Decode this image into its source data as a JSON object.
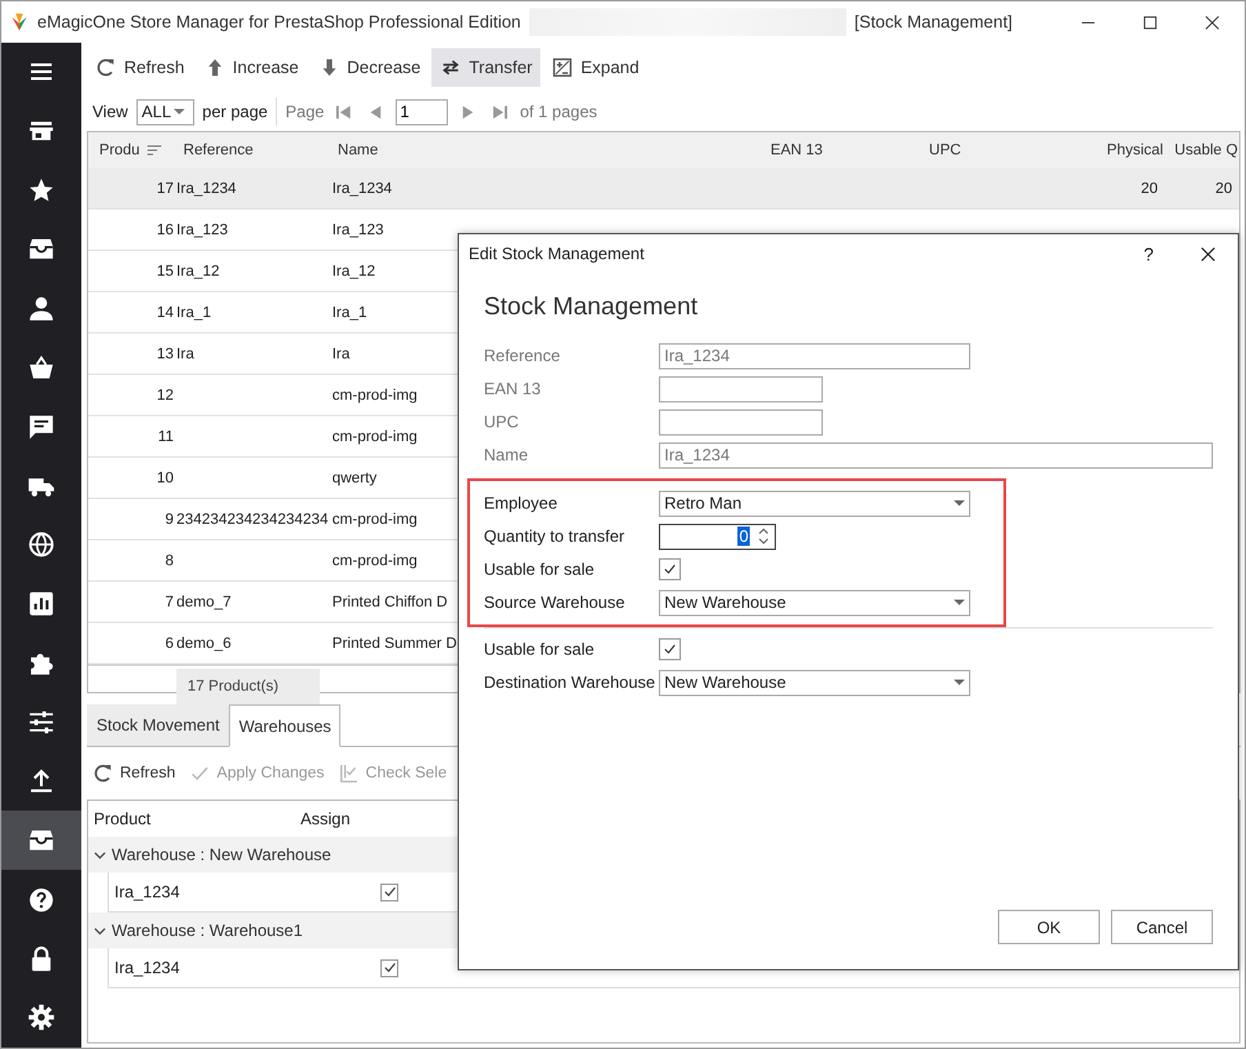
{
  "window": {
    "title": "eMagicOne Store Manager for PrestaShop Professional Edition",
    "subtitle": "[Stock Management]"
  },
  "sidebar": {
    "items": [
      {
        "kind": "menu",
        "selected": false
      },
      {
        "kind": "store",
        "selected": false
      },
      {
        "kind": "star",
        "selected": false
      },
      {
        "kind": "archive",
        "selected": false
      },
      {
        "kind": "person",
        "selected": false
      },
      {
        "kind": "basket",
        "selected": false
      },
      {
        "kind": "chat",
        "selected": false
      },
      {
        "kind": "truck",
        "selected": false
      },
      {
        "kind": "globe",
        "selected": false
      },
      {
        "kind": "chart",
        "selected": false
      },
      {
        "kind": "puzzle",
        "selected": false
      },
      {
        "kind": "sliders",
        "selected": false
      },
      {
        "kind": "upload",
        "selected": false
      },
      {
        "kind": "archive",
        "selected": true
      },
      {
        "kind": "help",
        "selected": false
      },
      {
        "kind": "lock",
        "selected": false
      },
      {
        "kind": "settings",
        "selected": false
      }
    ]
  },
  "toolbar": [
    {
      "kind": "refresh",
      "label": "Refresh",
      "selected": false
    },
    {
      "kind": "up",
      "label": "Increase",
      "selected": false
    },
    {
      "kind": "down",
      "label": "Decrease",
      "selected": false
    },
    {
      "kind": "transfer",
      "label": "Transfer",
      "selected": true
    },
    {
      "kind": "expand",
      "label": "Expand",
      "selected": false
    }
  ],
  "pager": {
    "view_label": "View",
    "view_value": "ALL",
    "per_page": "per page",
    "page_label": "Page",
    "page_value": "1",
    "of_pages": "of 1 pages"
  },
  "grid": {
    "columns": [
      "Produ",
      "Reference",
      "Name",
      "EAN 13",
      "UPC",
      "Physical",
      "Usable Q"
    ],
    "rows": [
      {
        "id": "17",
        "reference": "Ira_1234",
        "name": "Ira_1234",
        "physical": "20",
        "usable": "20",
        "selected": true
      },
      {
        "id": "16",
        "reference": "Ira_123",
        "name": "Ira_123",
        "selected": false
      },
      {
        "id": "15",
        "reference": "Ira_12",
        "name": "Ira_12",
        "selected": false
      },
      {
        "id": "14",
        "reference": "Ira_1",
        "name": "Ira_1",
        "selected": false
      },
      {
        "id": "13",
        "reference": "Ira",
        "name": "Ira",
        "selected": false
      },
      {
        "id": "12",
        "name": "cm-prod-img",
        "selected": false
      },
      {
        "id": "11",
        "name": "cm-prod-img",
        "selected": false
      },
      {
        "id": "10",
        "name": "qwerty",
        "selected": false
      },
      {
        "id": "9",
        "reference": "234234234234234234",
        "name": "cm-prod-img",
        "selected": false
      },
      {
        "id": "8",
        "name": "cm-prod-img",
        "selected": false
      },
      {
        "id": "7",
        "reference": "demo_7",
        "name": "Printed Chiffon D",
        "selected": false
      },
      {
        "id": "6",
        "reference": "demo_6",
        "name": "Printed Summer D",
        "selected": false
      }
    ],
    "footer": "17 Product(s)"
  },
  "bottom": {
    "tabs": [
      {
        "label": "Stock Movement",
        "selected": false
      },
      {
        "label": "Warehouses",
        "selected": true
      }
    ],
    "toolbar": [
      {
        "kind": "refresh",
        "label": "Refresh",
        "disabled": false
      },
      {
        "kind": "check",
        "label": "Apply Changes",
        "disabled": true
      },
      {
        "kind": "check-select",
        "label": "Check Sele",
        "disabled": true
      }
    ],
    "columns": [
      "Product",
      "Assign"
    ],
    "groups": [
      {
        "title": "Warehouse : New Warehouse",
        "expanded": true,
        "rows": [
          {
            "product": "Ira_1234",
            "assigned": true
          }
        ]
      },
      {
        "title": "Warehouse : Warehouse1",
        "expanded": true,
        "rows": [
          {
            "product": "Ira_1234",
            "assigned": true
          }
        ]
      }
    ]
  },
  "dialog": {
    "title": "Edit Stock Management",
    "help": "?",
    "heading": "Stock Management",
    "sections": [
      {
        "highlighted": false,
        "fields": [
          {
            "kind": "text",
            "label": "Reference",
            "value": "Ira_1234",
            "disabled": true
          },
          {
            "kind": "text",
            "label": "EAN 13",
            "disabled": true
          },
          {
            "kind": "text",
            "label": "UPC",
            "disabled": true
          },
          {
            "kind": "text",
            "label": "Name",
            "value": "Ira_1234",
            "disabled": true
          }
        ]
      },
      {
        "highlighted": true,
        "fields": [
          {
            "kind": "combo",
            "label": "Employee",
            "value": "Retro Man",
            "disabled": false
          },
          {
            "kind": "spin",
            "label": "Quantity to transfer",
            "value": "0",
            "disabled": false
          },
          {
            "kind": "checkbox",
            "label": "Usable for sale",
            "checked": true,
            "disabled": false
          },
          {
            "kind": "combo",
            "label": "Source Warehouse",
            "value": "New Warehouse",
            "disabled": false
          }
        ]
      },
      {
        "highlighted": false,
        "fields": [
          {
            "kind": "checkbox",
            "label": "Usable for sale",
            "checked": true,
            "disabled": false
          },
          {
            "kind": "combo",
            "label": "Destination Warehouse",
            "value": "New Warehouse",
            "disabled": false
          }
        ]
      }
    ],
    "buttons": [
      "OK",
      "Cancel"
    ]
  }
}
